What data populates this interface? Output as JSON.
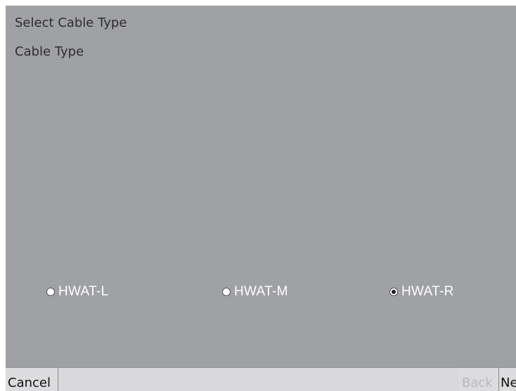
{
  "header": {
    "title": "Select Cable Type"
  },
  "section": {
    "label": "Cable Type"
  },
  "options": [
    {
      "label": "HWAT-L",
      "selected": false
    },
    {
      "label": "HWAT-M",
      "selected": false
    },
    {
      "label": "HWAT-R",
      "selected": true
    }
  ],
  "footer": {
    "cancel_label": "Cancel",
    "back_label": "Back",
    "next_label": "Ne"
  },
  "colors": {
    "panel_background": "#a0a1a4",
    "footer_background": "#d9d9db",
    "option_text": "#ffffff",
    "disabled_text": "#b8b8bb"
  },
  "icons": {
    "radio_unselected": "radio-unselected-icon",
    "radio_selected": "radio-selected-icon"
  }
}
